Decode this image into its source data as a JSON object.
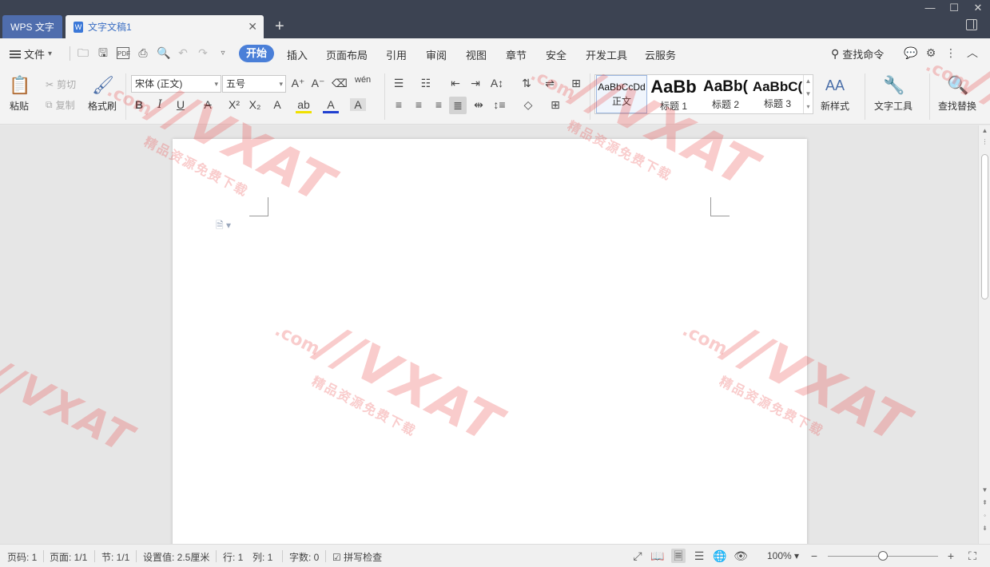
{
  "titlebar": {
    "app_tab": "WPS 文字",
    "doc_tab": "文字文稿1",
    "doc_icon_letter": "W",
    "new_tab": "+",
    "close": "✕",
    "minimize": "—",
    "maximize": "☐",
    "win_close": "✕"
  },
  "menubar": {
    "file": "文件",
    "active_tab": "开始",
    "tabs": [
      "插入",
      "页面布局",
      "引用",
      "审阅",
      "视图",
      "章节",
      "安全",
      "开发工具",
      "云服务"
    ],
    "search_cmd": "查找命令"
  },
  "ribbon": {
    "paste": "粘贴",
    "cut": "剪切",
    "copy": "复制",
    "format_painter": "格式刷",
    "font_name": "宋体 (正文)",
    "font_size": "五号",
    "styles": [
      {
        "preview": "AaBbCcDd",
        "name": "正文"
      },
      {
        "preview": "AaBb",
        "name": "标题 1"
      },
      {
        "preview": "AaBb(",
        "name": "标题 2"
      },
      {
        "preview": "AaBbC(",
        "name": "标题 3"
      }
    ],
    "new_style": "新样式",
    "text_tools": "文字工具",
    "find_replace": "查找替换"
  },
  "watermark": {
    "brand": "//VXAT",
    "domain": ".com",
    "cn": "精品资源免费下载"
  },
  "statusbar": {
    "page_num": "页码: 1",
    "pages": "页面: 1/1",
    "section": "节: 1/1",
    "setting": "设置值: 2.5厘米",
    "row": "行: 1",
    "col": "列: 1",
    "word_count": "字数: 0",
    "spell_check": "拼写检查",
    "zoom": "100% ▾"
  },
  "colors": {
    "titlebar": "#3c4352",
    "app_tab": "#4f6dad",
    "active_tab": "#4a7fd8",
    "watermark": "#e94848"
  }
}
